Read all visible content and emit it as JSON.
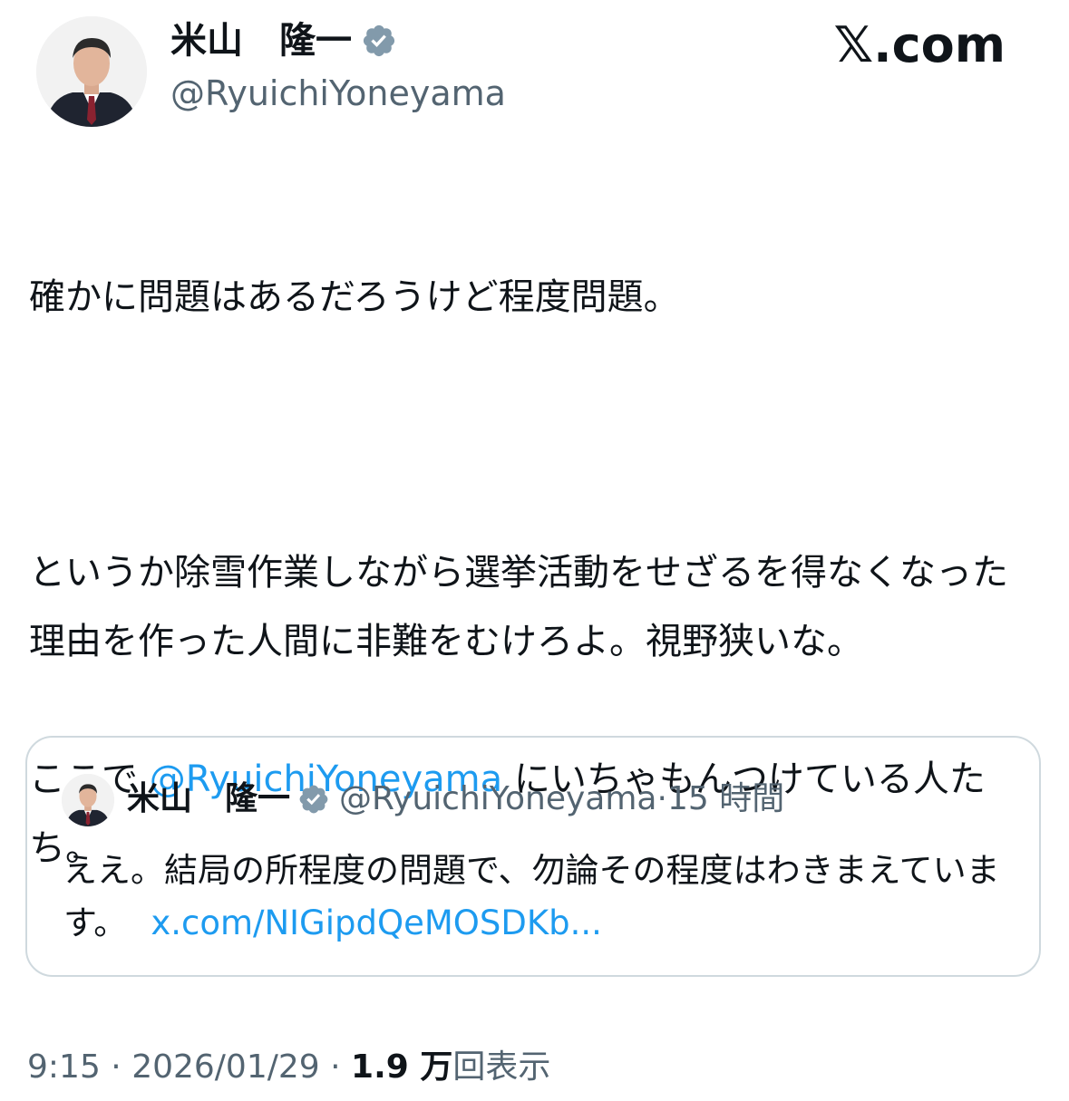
{
  "author": {
    "name": "米山　隆一",
    "handle": "@RyuichiYoneyama",
    "verified_color": "#829aab",
    "avatar": "profile-photo"
  },
  "brand": {
    "label": "𝕏.com"
  },
  "tweet": {
    "paragraph1": "確かに問題はあるだろうけど程度問題。",
    "paragraph2": "というか除雪作業しながら選挙活動をせざるを得なくなった理由を作った人間に非難をむけろよ。視野狭いな。",
    "paragraph3_before": "ここで ",
    "mention": "@RyuichiYoneyama",
    "paragraph3_after": " にいちゃもんつけている人たち。"
  },
  "quote": {
    "name": "米山　隆一",
    "handle": "@RyuichiYoneyama",
    "separator": "·",
    "time": "15 時間",
    "text": "ええ。結局の所程度の問題で、勿論その程度はわきまえています。",
    "link": "x.com/NIGipdQeMOSDKb..."
  },
  "footer": {
    "time": "9:15",
    "sep1": " · ",
    "date": "2026/01/29",
    "sep2": " · ",
    "views_count": "1.9 万",
    "views_label": "回表示"
  },
  "colors": {
    "link": "#1d9bf0",
    "muted": "#536471",
    "border": "#cfd9de"
  }
}
